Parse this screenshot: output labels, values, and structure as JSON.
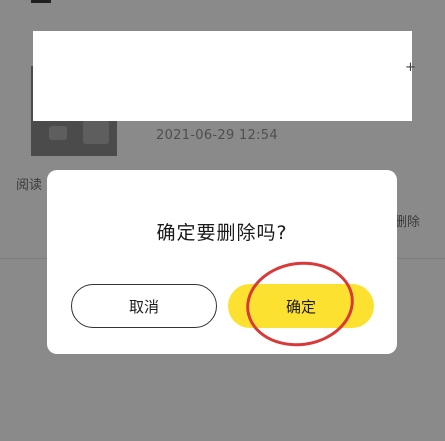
{
  "background": {
    "article_date": "2021-06-29 12:54",
    "read_label": "阅读",
    "delete_label": "删除",
    "edge_glyph": "+"
  },
  "dialog": {
    "title": "确定要删除吗?",
    "cancel_label": "取消",
    "confirm_label": "确定"
  },
  "colors": {
    "overlay": "#8a8a8a",
    "confirm_accent": "#fde130",
    "annotation": "#d83a3a"
  }
}
